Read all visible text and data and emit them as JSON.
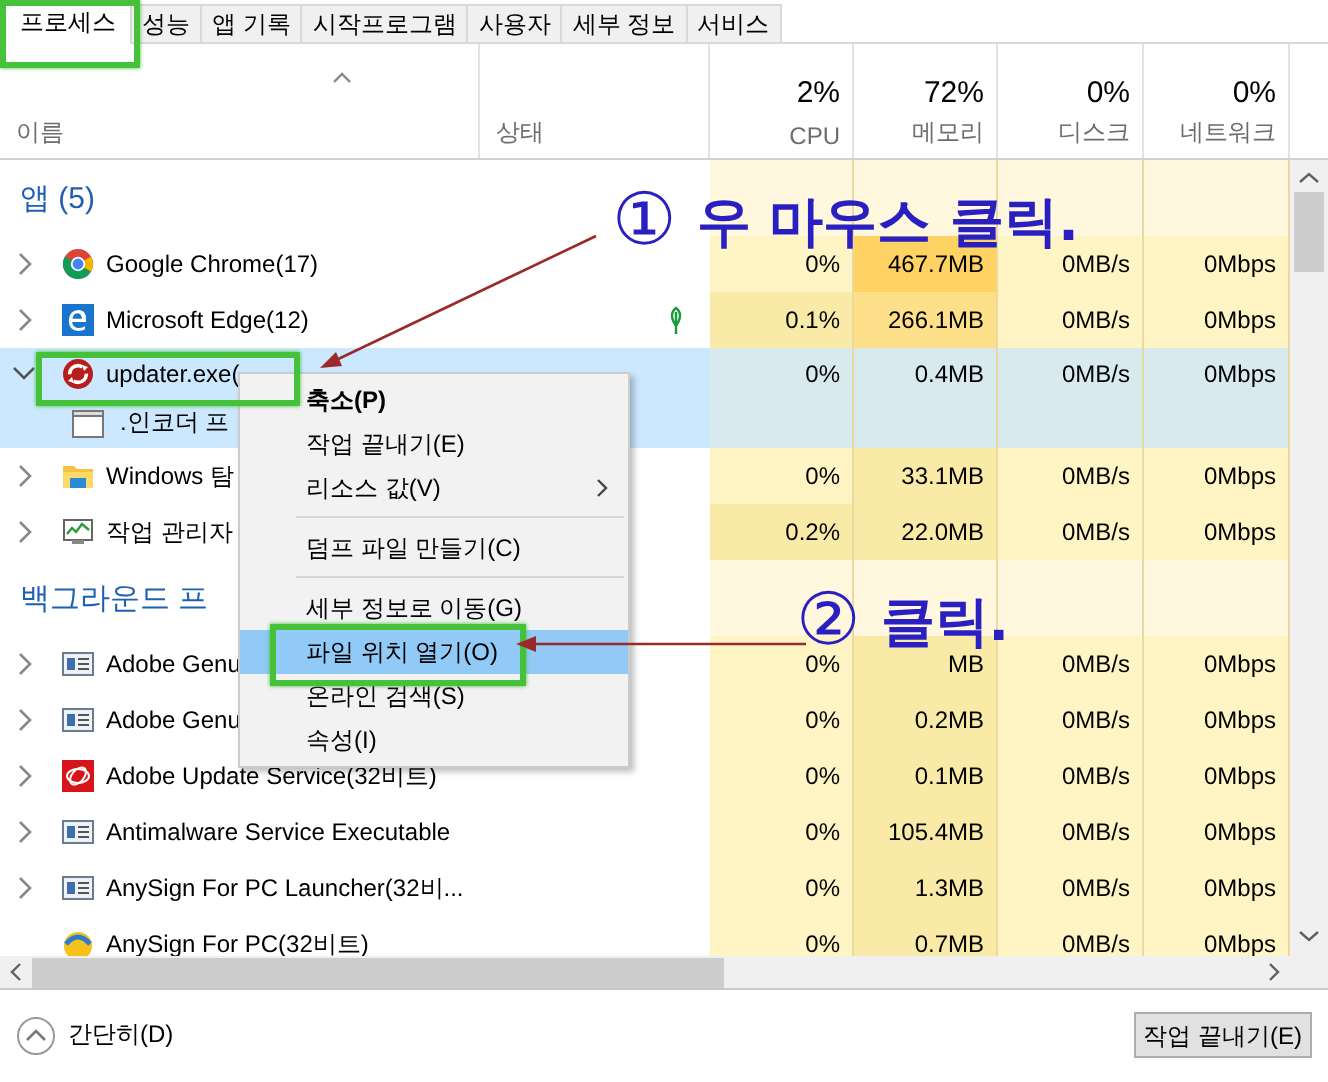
{
  "tabs": [
    {
      "label": "프로세스",
      "selected": true
    },
    {
      "label": "성능",
      "selected": false
    },
    {
      "label": "앱 기록",
      "selected": false
    },
    {
      "label": "시작프로그램",
      "selected": false
    },
    {
      "label": "사용자",
      "selected": false
    },
    {
      "label": "세부 정보",
      "selected": false
    },
    {
      "label": "서비스",
      "selected": false
    }
  ],
  "columns": [
    {
      "label": "이름"
    },
    {
      "label": "상태"
    },
    {
      "label": "CPU",
      "total": "2%"
    },
    {
      "label": "메모리",
      "total": "72%"
    },
    {
      "label": "디스크",
      "total": "0%"
    },
    {
      "label": "네트워크",
      "total": "0%"
    }
  ],
  "groups": [
    {
      "title": "앱 (5)",
      "rows": [
        {
          "name": "Google Chrome(17)",
          "kind": "chrome",
          "expanded": false,
          "selected": false,
          "suspended": false,
          "cells": [
            {
              "text": "0%",
              "color": "#fff4c4"
            },
            {
              "text": "467.7MB",
              "color": "#ffd264"
            },
            {
              "text": "0MB/s",
              "color": "#fff4c4"
            },
            {
              "text": "0Mbps",
              "color": "#fff4c4"
            }
          ]
        },
        {
          "name": "Microsoft Edge(12)",
          "kind": "edge",
          "expanded": false,
          "selected": false,
          "suspended": true,
          "cells": [
            {
              "text": "0.1%",
              "color": "#f9eaa8"
            },
            {
              "text": "266.1MB",
              "color": "#ffe08a"
            },
            {
              "text": "0MB/s",
              "color": "#fff4c4"
            },
            {
              "text": "0Mbps",
              "color": "#fff4c4"
            }
          ]
        },
        {
          "name": "updater.exe(",
          "kind": "updater",
          "expanded": true,
          "selected": true,
          "suspended": false,
          "cells": [
            {
              "text": "0%",
              "color": "#d8eaee"
            },
            {
              "text": "0.4MB",
              "color": "#d8eaee"
            },
            {
              "text": "0MB/s",
              "color": "#d8eaee"
            },
            {
              "text": "0Mbps",
              "color": "#d8eaee"
            }
          ],
          "children": [
            {
              "name": ".인코더 프",
              "kind": "window",
              "selected": true
            }
          ]
        },
        {
          "name": "Windows 탐",
          "kind": "folder",
          "expanded": false,
          "selected": false,
          "suspended": false,
          "cells": [
            {
              "text": "0%",
              "color": "#fff4c4"
            },
            {
              "text": "33.1MB",
              "color": "#f9eaa8"
            },
            {
              "text": "0MB/s",
              "color": "#fff4c4"
            },
            {
              "text": "0Mbps",
              "color": "#fff4c4"
            }
          ]
        },
        {
          "name": "작업 관리자",
          "kind": "monitor",
          "expanded": false,
          "selected": false,
          "suspended": false,
          "cells": [
            {
              "text": "0.2%",
              "color": "#f9eaa8"
            },
            {
              "text": "22.0MB",
              "color": "#f9eaa8"
            },
            {
              "text": "0MB/s",
              "color": "#fff4c4"
            },
            {
              "text": "0Mbps",
              "color": "#fff4c4"
            }
          ]
        }
      ]
    },
    {
      "title": "백그라운드 프",
      "rows": [
        {
          "name": "Adobe Genu",
          "kind": "service",
          "expanded": false,
          "selected": false,
          "suspended": false,
          "cells": [
            {
              "text": "0%",
              "color": "#fff4c4"
            },
            {
              "text": "MB",
              "color": "#f9eaa8"
            },
            {
              "text": "0MB/s",
              "color": "#fff4c4"
            },
            {
              "text": "0Mbps",
              "color": "#fff4c4"
            }
          ]
        },
        {
          "name": "Adobe Genu",
          "kind": "service",
          "expanded": false,
          "selected": false,
          "suspended": false,
          "cells": [
            {
              "text": "0%",
              "color": "#fff4c4"
            },
            {
              "text": "0.2MB",
              "color": "#f9eaa8"
            },
            {
              "text": "0MB/s",
              "color": "#fff4c4"
            },
            {
              "text": "0Mbps",
              "color": "#fff4c4"
            }
          ]
        },
        {
          "name": "Adobe Update Service(32비트)",
          "kind": "adobe",
          "expanded": false,
          "selected": false,
          "suspended": false,
          "cells": [
            {
              "text": "0%",
              "color": "#fff4c4"
            },
            {
              "text": "0.1MB",
              "color": "#f9eaa8"
            },
            {
              "text": "0MB/s",
              "color": "#fff4c4"
            },
            {
              "text": "0Mbps",
              "color": "#fff4c4"
            }
          ]
        },
        {
          "name": "Antimalware Service Executable",
          "kind": "service",
          "expanded": false,
          "selected": false,
          "suspended": false,
          "cells": [
            {
              "text": "0%",
              "color": "#fff4c4"
            },
            {
              "text": "105.4MB",
              "color": "#f9eaa8"
            },
            {
              "text": "0MB/s",
              "color": "#fff4c4"
            },
            {
              "text": "0Mbps",
              "color": "#fff4c4"
            }
          ]
        },
        {
          "name": "AnySign For PC Launcher(32비...",
          "kind": "service",
          "expanded": false,
          "selected": false,
          "suspended": false,
          "cells": [
            {
              "text": "0%",
              "color": "#fff4c4"
            },
            {
              "text": "1.3MB",
              "color": "#f9eaa8"
            },
            {
              "text": "0MB/s",
              "color": "#fff4c4"
            },
            {
              "text": "0Mbps",
              "color": "#fff4c4"
            }
          ]
        },
        {
          "name": "AnySign For PC(32비트)",
          "kind": "anysign",
          "selected": false,
          "suspended": false,
          "cells": [
            {
              "text": "0%",
              "color": "#fff4c4"
            },
            {
              "text": "0.7MB",
              "color": "#f9eaa8"
            },
            {
              "text": "0MB/s",
              "color": "#fff4c4"
            },
            {
              "text": "0Mbps",
              "color": "#fff4c4"
            }
          ]
        }
      ]
    }
  ],
  "context_menu": [
    {
      "kind": "item",
      "label": "축소(P)",
      "default": true,
      "selected": false,
      "submenu": false
    },
    {
      "kind": "item",
      "label": "작업 끝내기(E)",
      "default": false,
      "selected": false,
      "submenu": false
    },
    {
      "kind": "item",
      "label": "리소스 값(V)",
      "default": false,
      "selected": false,
      "submenu": true
    },
    {
      "kind": "separator"
    },
    {
      "kind": "item",
      "label": "덤프 파일 만들기(C)",
      "default": false,
      "selected": false,
      "submenu": false
    },
    {
      "kind": "separator"
    },
    {
      "kind": "item",
      "label": "세부 정보로 이동(G)",
      "default": false,
      "selected": false,
      "submenu": false
    },
    {
      "kind": "item",
      "label": "파일 위치 열기(O)",
      "default": false,
      "selected": true,
      "submenu": false
    },
    {
      "kind": "item",
      "label": "온라인 검색(S)",
      "default": false,
      "selected": false,
      "submenu": false
    },
    {
      "kind": "item",
      "label": "속성(I)",
      "default": false,
      "selected": false,
      "submenu": false
    }
  ],
  "annotations": [
    {
      "number": "①",
      "text": "우 마우스 클릭."
    },
    {
      "number": "②",
      "text": "클릭."
    }
  ],
  "footer": {
    "fewer_details": "간단히(D)",
    "end_task": "작업 끝내기(E)"
  }
}
